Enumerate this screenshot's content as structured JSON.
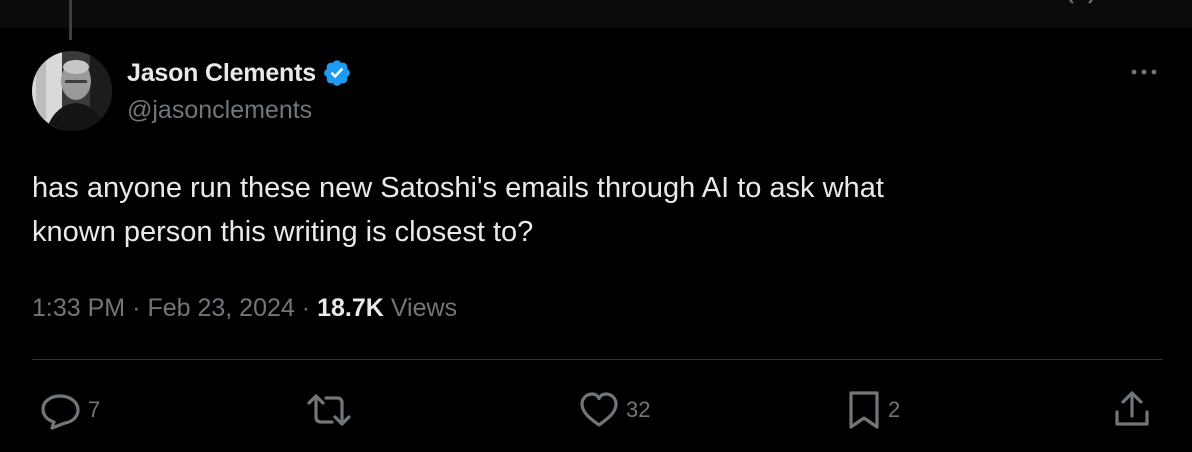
{
  "author": {
    "display_name": "Jason Clements",
    "handle": "@jasonclements",
    "verified": true,
    "avatar_icon": "profile-photo",
    "verified_icon": "verified-badge-icon",
    "verified_color": "#1d9bf0"
  },
  "tweet": {
    "text": "has anyone run these new Satoshi's emails through AI to ask what\nknown person this writing is closest to?",
    "time": "1:33 PM",
    "date": "Feb 23, 2024",
    "separator": "·",
    "views_count": "18.7K",
    "views_label": "Views"
  },
  "actions": {
    "reply": {
      "icon": "reply-icon",
      "count": "7"
    },
    "repost": {
      "icon": "repost-icon",
      "count": ""
    },
    "like": {
      "icon": "heart-icon",
      "count": "32"
    },
    "bookmark": {
      "icon": "bookmark-icon",
      "count": "2"
    },
    "share": {
      "icon": "share-icon"
    }
  },
  "menu": {
    "icon": "more-icon"
  },
  "colors": {
    "background": "#000000",
    "text_primary": "#e7e9ea",
    "text_secondary": "#71767b",
    "divider": "#2f3336"
  }
}
